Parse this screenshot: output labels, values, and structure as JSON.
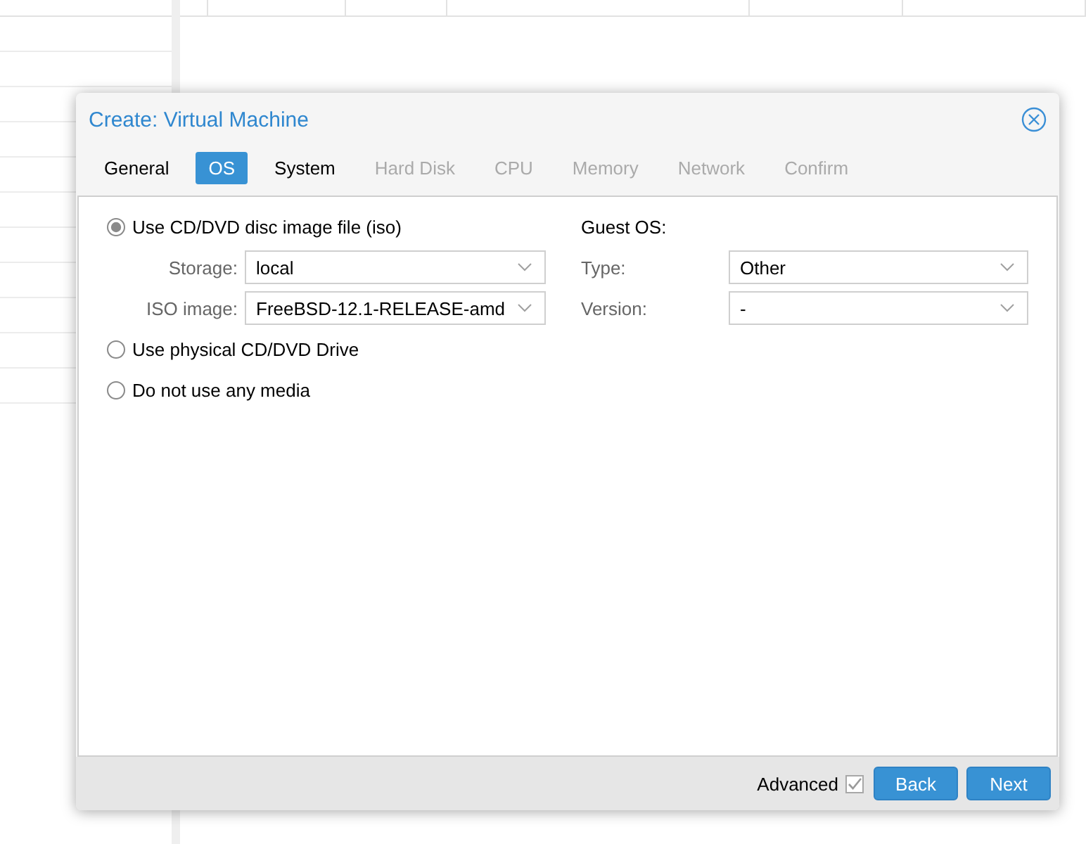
{
  "window": {
    "title": "Create: Virtual Machine"
  },
  "tabs": [
    {
      "label": "General",
      "selected": false,
      "disabled": false
    },
    {
      "label": "OS",
      "selected": true,
      "disabled": false
    },
    {
      "label": "System",
      "selected": false,
      "disabled": false
    },
    {
      "label": "Hard Disk",
      "selected": false,
      "disabled": true
    },
    {
      "label": "CPU",
      "selected": false,
      "disabled": true
    },
    {
      "label": "Memory",
      "selected": false,
      "disabled": true
    },
    {
      "label": "Network",
      "selected": false,
      "disabled": true
    },
    {
      "label": "Confirm",
      "selected": false,
      "disabled": true
    }
  ],
  "media_options": [
    {
      "label": "Use CD/DVD disc image file (iso)",
      "selected": true,
      "fields": [
        {
          "label": "Storage:",
          "value": "local"
        },
        {
          "label": "ISO image:",
          "value": "FreeBSD-12.1-RELEASE-amd"
        }
      ]
    },
    {
      "label": "Use physical CD/DVD Drive",
      "selected": false
    },
    {
      "label": "Do not use any media",
      "selected": false
    }
  ],
  "guest_os": {
    "heading": "Guest OS:",
    "fields": [
      {
        "label": "Type:",
        "value": "Other"
      },
      {
        "label": "Version:",
        "value": "-"
      }
    ]
  },
  "footer": {
    "advanced": {
      "label": "Advanced",
      "checked": true
    },
    "buttons": [
      {
        "label": "Back"
      },
      {
        "label": "Next"
      }
    ]
  }
}
